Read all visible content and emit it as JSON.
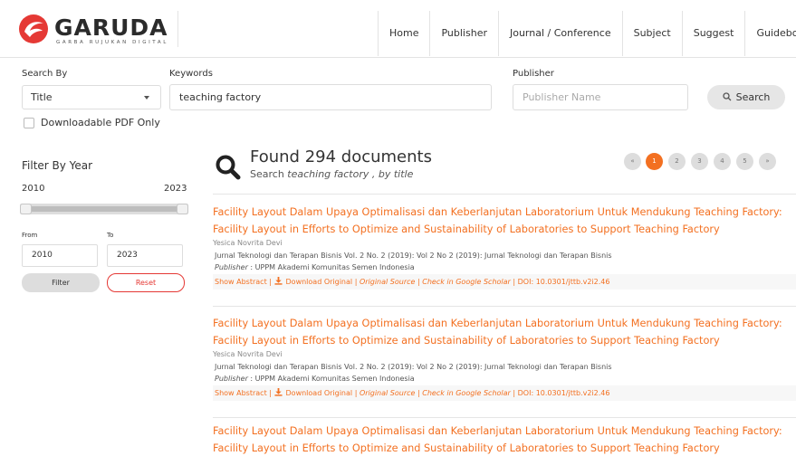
{
  "header": {
    "logo_text": "GARUDA",
    "logo_sub": "GARBA RUJUKAN DIGITAL",
    "nav": [
      "Home",
      "Publisher",
      "Journal / Conference",
      "Subject",
      "Suggest",
      "Guidebook"
    ]
  },
  "search": {
    "search_by_label": "Search By",
    "search_by_value": "Title",
    "keywords_label": "Keywords",
    "keywords_value": "teaching factory",
    "publisher_label": "Publisher",
    "publisher_placeholder": "Publisher Name",
    "search_button": "Search",
    "downloadable_label": "Downloadable PDF Only"
  },
  "sidebar": {
    "filter_title": "Filter By Year",
    "range_min": "2010",
    "range_max": "2023",
    "from_label": "From",
    "to_label": "To",
    "from_value": "2010",
    "to_value": "2023",
    "filter_button": "Filter",
    "reset_button": "Reset"
  },
  "results_header": {
    "found_text": "Found 294 documents",
    "search_prefix": "Search ",
    "search_query": "teaching factory",
    "search_suffix": " , by title"
  },
  "pagination": [
    "«",
    "1",
    "2",
    "3",
    "4",
    "5",
    "»"
  ],
  "pagination_active": "1",
  "results": [
    {
      "title": "Facility Layout Dalam Upaya Optimalisasi dan Keberlanjutan Laboratorium Untuk Mendukung Teaching Factory: Facility Layout in Efforts to Optimize and Sustainability of Laboratories to Support Teaching Factory",
      "author": "Yesica Novrita Devi",
      "journal": "Jurnal Teknologi dan Terapan Bisnis Vol. 2 No. 2 (2019): Vol 2 No 2 (2019): Jurnal Teknologi dan Terapan Bisnis",
      "publisher_label": "Publisher",
      "publisher": " : UPPM Akademi Komunitas Semen Indonesia",
      "show_abstract": "Show Abstract",
      "download": "Download Original",
      "original_source": "Original Source",
      "scholar": "Check in Google Scholar",
      "doi": "DOI: 10.0301/jttb.v2i2.46"
    },
    {
      "title": "Facility Layout Dalam Upaya Optimalisasi dan Keberlanjutan Laboratorium Untuk Mendukung Teaching Factory: Facility Layout in Efforts to Optimize and Sustainability of Laboratories to Support Teaching Factory",
      "author": "Yesica Novrita Devi",
      "journal": "Jurnal Teknologi dan Terapan Bisnis Vol. 2 No. 2 (2019): Vol 2 No 2 (2019): Jurnal Teknologi dan Terapan Bisnis",
      "publisher_label": "Publisher",
      "publisher": " : UPPM Akademi Komunitas Semen Indonesia",
      "show_abstract": "Show Abstract",
      "download": "Download Original",
      "original_source": "Original Source",
      "scholar": "Check in Google Scholar",
      "doi": "DOI: 10.0301/jttb.v2i2.46"
    },
    {
      "title": "Facility Layout Dalam Upaya Optimalisasi dan Keberlanjutan Laboratorium Untuk Mendukung Teaching Factory: Facility Layout in Efforts to Optimize and Sustainability of Laboratories to Support Teaching Factory"
    }
  ],
  "colors": {
    "accent": "#f37021",
    "brand_red": "#e53935",
    "reset_border": "#e53935"
  },
  "icons": {
    "logo": "garuda-logo-icon",
    "search": "magnifier-icon",
    "download": "download-icon",
    "caret": "chevron-down-icon"
  }
}
